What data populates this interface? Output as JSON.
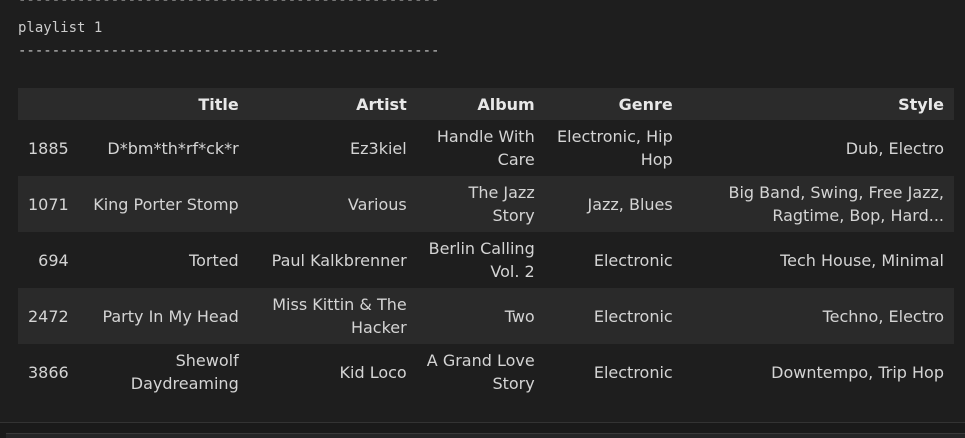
{
  "output": {
    "separator": "--------------------------------------------------",
    "playlist_title": "playlist 1"
  },
  "table": {
    "headers": [
      "",
      "Title",
      "Artist",
      "Album",
      "Genre",
      "Style"
    ],
    "rows": [
      {
        "index": "1885",
        "title": "D*bm*th*rf*ck*r",
        "artist": "Ez3kiel",
        "album": "Handle With Care",
        "genre": "Electronic, Hip Hop",
        "style": "Dub, Electro"
      },
      {
        "index": "1071",
        "title": "King Porter Stomp",
        "artist": "Various",
        "album": "The Jazz Story",
        "genre": "Jazz, Blues",
        "style": "Big Band, Swing, Free Jazz, Ragtime, Bop, Hard..."
      },
      {
        "index": "694",
        "title": "Torted",
        "artist": "Paul Kalkbrenner",
        "album": "Berlin Calling Vol. 2",
        "genre": "Electronic",
        "style": "Tech House, Minimal"
      },
      {
        "index": "2472",
        "title": "Party In My Head",
        "artist": "Miss Kittin & The Hacker",
        "album": "Two",
        "genre": "Electronic",
        "style": "Techno, Electro"
      },
      {
        "index": "3866",
        "title": "Shewolf Daydreaming",
        "artist": "Kid Loco",
        "album": "A Grand Love Story",
        "genre": "Electronic",
        "style": "Downtempo, Trip Hop"
      }
    ]
  }
}
